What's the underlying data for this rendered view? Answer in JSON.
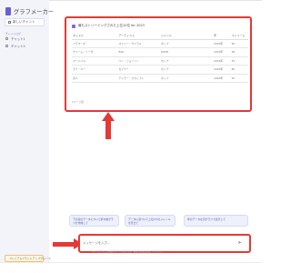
{
  "sidebar": {
    "brand": "グラフメーカー",
    "new_chat_label": "新しいチャット",
    "section_label": "チャットログ",
    "history": [
      {
        "label": "チャット1"
      },
      {
        "label": "チャット2"
      }
    ],
    "upgrade_label": "プレミアムプランにアップグレード"
  },
  "panel": {
    "title": "最もストリーミングされた上位10位 for 2023",
    "columns": [
      "タイトル",
      "アーティスト",
      "ジャンル",
      "年",
      "ストリーム"
    ],
    "rows": [
      [
        "フラワーズ",
        "マイリー・サイラス",
        "ポップ",
        "2023年",
        "90"
      ],
      [
        "クリーム・ソーダ",
        "EXO",
        "K-POP",
        "2023年",
        "58"
      ],
      [
        "カーニバル",
        "ベン・ジョンソン",
        "ポップ",
        "2023年",
        "55"
      ],
      [
        "ラブ・ユー",
        "セイヤー",
        "ポップ",
        "2023年",
        "80"
      ],
      [
        "恋人",
        "テイラー・スウィフト",
        "ポップ",
        "2023年",
        "55"
      ]
    ],
    "pager_label": "1ページ目"
  },
  "suggestions": [
    "下の表のデータについて折れ線グラフを作成して",
    "データに基づいて上位3つのジャンルを見せて",
    "年のデータを円グラフで表示して"
  ],
  "input": {
    "placeholder": "メッセージを入力..."
  },
  "disclaimer": "グラフメーカーは間違えることがあります。重要な情報を確認してください。",
  "colors": {
    "accent": "#6b5fd6",
    "highlight": "#e53935",
    "sidebar_bg": "#f3f4fa"
  },
  "icons": {
    "brand": "chart-icon",
    "send": "send-icon"
  }
}
